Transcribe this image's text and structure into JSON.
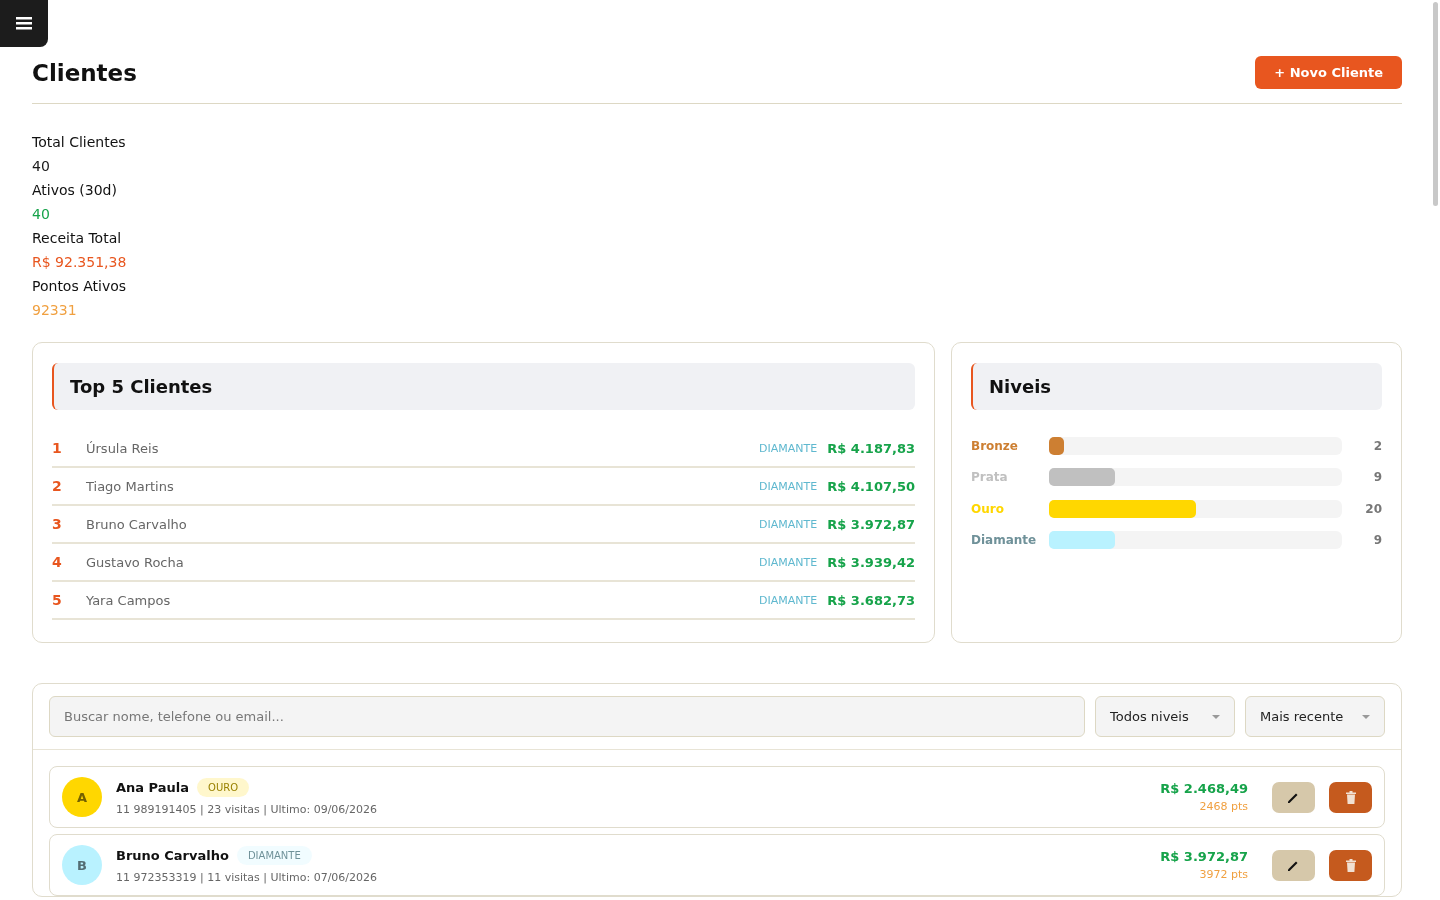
{
  "header": {
    "title": "Clientes",
    "new_button": "+ Novo Cliente"
  },
  "stats": [
    {
      "label": "Total Clientes",
      "value": "40",
      "color": "#1a1a1a"
    },
    {
      "label": "Ativos (30d)",
      "value": "40",
      "color": "#16a34a"
    },
    {
      "label": "Receita Total",
      "value": "R$ 92.351,38",
      "color": "#e8561f"
    },
    {
      "label": "Pontos Ativos",
      "value": "92331",
      "color": "#f0a040"
    }
  ],
  "top_clients": {
    "title": "Top 5 Clientes",
    "rows": [
      {
        "rank": "1",
        "name": "Úrsula Reis",
        "tier": "DIAMANTE",
        "amount": "R$ 4.187,83"
      },
      {
        "rank": "2",
        "name": "Tiago Martins",
        "tier": "DIAMANTE",
        "amount": "R$ 4.107,50"
      },
      {
        "rank": "3",
        "name": "Bruno Carvalho",
        "tier": "DIAMANTE",
        "amount": "R$ 3.972,87"
      },
      {
        "rank": "4",
        "name": "Gustavo Rocha",
        "tier": "DIAMANTE",
        "amount": "R$ 3.939,42"
      },
      {
        "rank": "5",
        "name": "Yara Campos",
        "tier": "DIAMANTE",
        "amount": "R$ 3.682,73"
      }
    ]
  },
  "levels": {
    "title": "Niveis",
    "items": [
      {
        "name": "Bronze",
        "color": "#cd7f32",
        "level": 0.05,
        "count": "2"
      },
      {
        "name": "Prata",
        "color": "#c0c0c0",
        "level": 0.225,
        "count": "9"
      },
      {
        "name": "Ouro",
        "color": "#ffd700",
        "level": 0.5,
        "count": "20"
      },
      {
        "name": "Diamante",
        "color": "#b9f2ff",
        "level": 0.225,
        "count": "9"
      }
    ]
  },
  "filters": {
    "search": {
      "placeholder": "Buscar nome, telefone ou email..."
    },
    "level_select": "Todos niveis",
    "sort_select": "Mais recente"
  },
  "clients": [
    {
      "initial": "A",
      "name": "Ana Paula",
      "tier": "OURO",
      "color": "#ffd700",
      "info": "11 989191405 | 23 visitas | Ultimo: 09/06/2026",
      "amount": "R$ 2.468,49",
      "points": "2468 pts"
    },
    {
      "initial": "B",
      "name": "Bruno Carvalho",
      "tier": "DIAMANTE",
      "color": "#b9f2ff",
      "info": "11 972353319 | 11 visitas | Ultimo: 07/06/2026",
      "amount": "R$ 3.972,87",
      "points": "3972 pts"
    }
  ]
}
